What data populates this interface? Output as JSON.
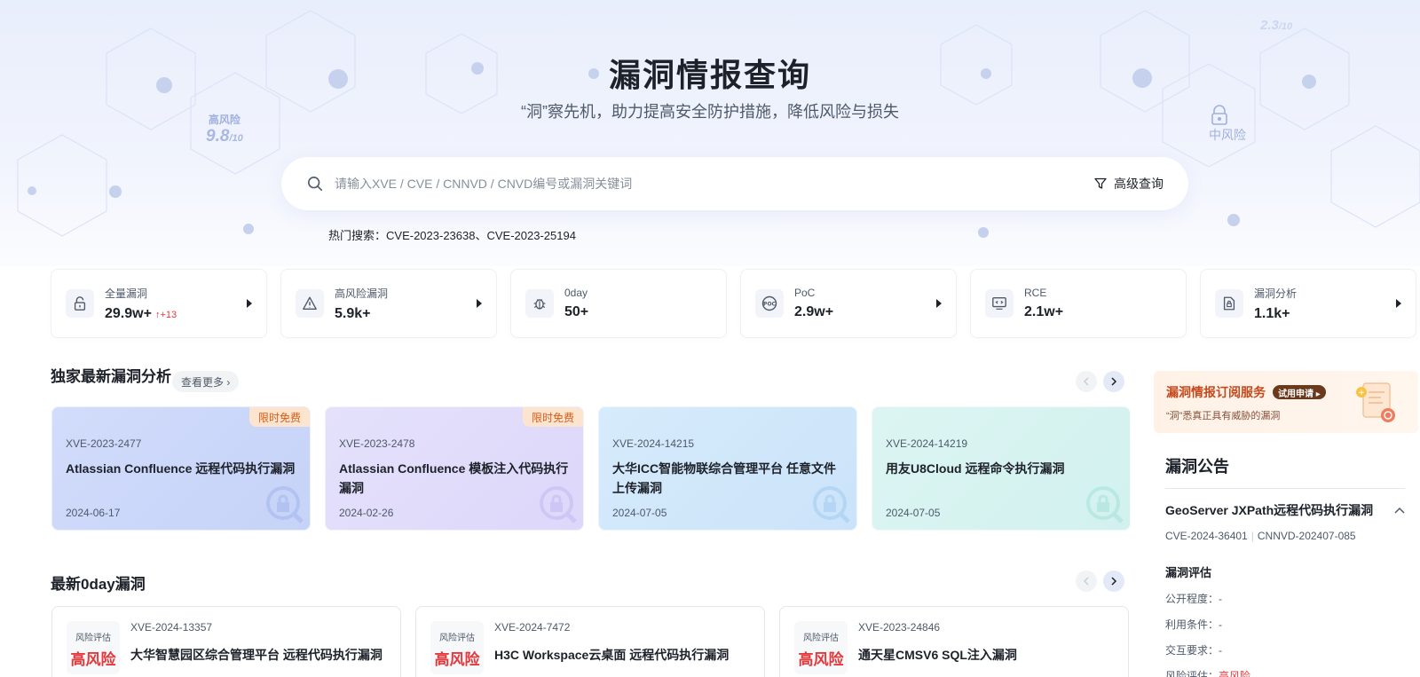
{
  "hero": {
    "title": "漏洞情报查询",
    "subtitle": "“洞”察先机，助力提高安全防护措施，降低风险与损失",
    "deco_high_label": "高风险",
    "deco_high_score": "9.8",
    "deco_high_max": "/10",
    "deco_mid_label": "中风险",
    "deco_faint_value": "2.3",
    "deco_faint_max": "/10"
  },
  "search": {
    "placeholder": "请输入XVE / CVE / CNNVD / CNVD编号或漏洞关键词",
    "value": "",
    "advanced_label": "高级查询",
    "hot_label": "热门搜索：",
    "hot_items": [
      "CVE-2023-23638",
      "CVE-2023-25194"
    ],
    "hot_separator": "、"
  },
  "stats": [
    {
      "label": "全量漏洞",
      "value": "29.9w+",
      "delta": "↑+13",
      "icon": "lock-icon"
    },
    {
      "label": "高风险漏洞",
      "value": "5.9k+",
      "delta": "",
      "icon": "warning-icon"
    },
    {
      "label": "0day",
      "value": "50+",
      "delta": "",
      "icon": "bug-icon"
    },
    {
      "label": "PoC",
      "value": "2.9w+",
      "delta": "",
      "icon": "poc-icon"
    },
    {
      "label": "RCE",
      "value": "2.1w+",
      "delta": "",
      "icon": "code-icon"
    },
    {
      "label": "漏洞分析",
      "value": "1.1k+",
      "delta": "",
      "icon": "doc-lock-icon"
    }
  ],
  "exclusive": {
    "title": "独家最新漏洞分析",
    "more_label": "查看更多 ›",
    "cards": [
      {
        "badge": "限时免费",
        "id": "XVE-2023-2477",
        "name": "Atlassian Confluence 远程代码执行漏洞",
        "date": "2024-06-17"
      },
      {
        "badge": "限时免费",
        "id": "XVE-2023-2478",
        "name": "Atlassian Confluence 模板注入代码执行漏洞",
        "date": "2024-02-26"
      },
      {
        "badge": "",
        "id": "XVE-2024-14215",
        "name": "大华ICC智能物联综合管理平台 任意文件上传漏洞",
        "date": "2024-07-05"
      },
      {
        "badge": "",
        "id": "XVE-2024-14219",
        "name": "用友U8Cloud 远程命令执行漏洞",
        "date": "2024-07-05"
      }
    ]
  },
  "zeroday": {
    "title": "最新0day漏洞",
    "cards": [
      {
        "risk_label": "风险评估",
        "risk": "高风险",
        "id": "XVE-2024-13357",
        "name": "大华智慧园区综合管理平台 远程代码执行漏洞"
      },
      {
        "risk_label": "风险评估",
        "risk": "高风险",
        "id": "XVE-2024-7472",
        "name": "H3C Workspace云桌面 远程代码执行漏洞"
      },
      {
        "risk_label": "风险评估",
        "risk": "高风险",
        "id": "XVE-2023-24846",
        "name": "通天星CMSV6 SQL注入漏洞"
      }
    ]
  },
  "promo": {
    "title": "漏洞情报订阅服务",
    "try_label": "试用申请 ▸",
    "subtitle": "“洞”悉真正具有威胁的漏洞"
  },
  "notice": {
    "title": "漏洞公告",
    "item_title": "GeoServer JXPath远程代码执行漏洞",
    "cve": "CVE-2024-36401",
    "cnnvd": "CNNVD-202407-085",
    "eval_title": "漏洞评估",
    "rows": [
      {
        "label": "公开程度：",
        "value": "-"
      },
      {
        "label": "利用条件：",
        "value": "-"
      },
      {
        "label": "交互要求：",
        "value": "-"
      },
      {
        "label": "风险评估：",
        "value": "高风险"
      }
    ]
  },
  "colors": {
    "accent": "#1d2129",
    "danger": "#e5383b",
    "badge_bg": "#fce4cf",
    "badge_text": "#d25f1a"
  }
}
